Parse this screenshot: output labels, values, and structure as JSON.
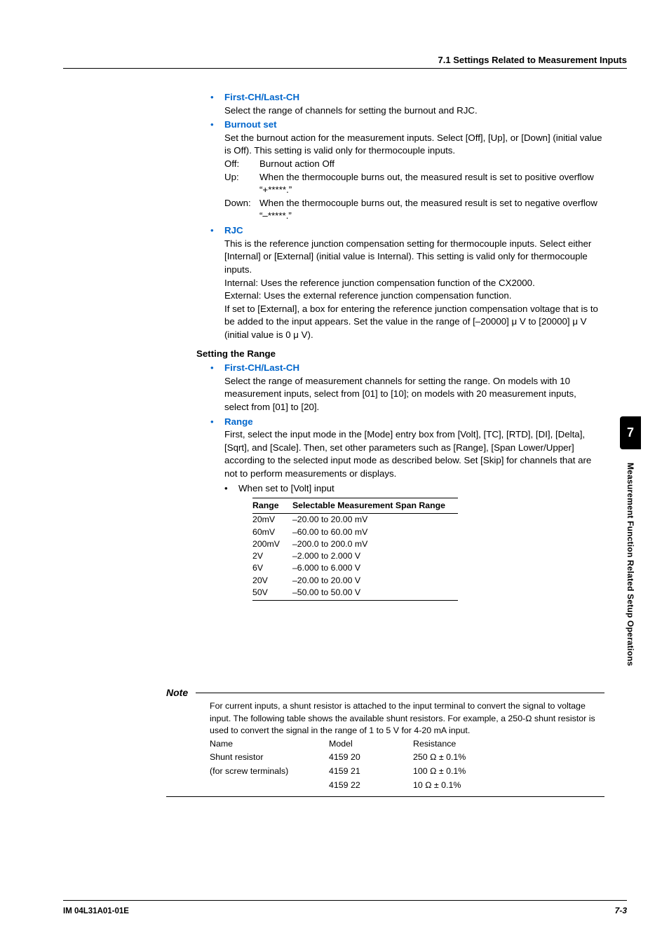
{
  "header": {
    "section": "7.1  Settings Related to Measurement Inputs"
  },
  "footer": {
    "left": "IM 04L31A01-01E",
    "right": "7-3"
  },
  "side": {
    "chapter": "7",
    "title": "Measurement Function Related Setup Operations"
  },
  "b1": {
    "h": "First-CH/Last-CH",
    "p": "Select the range of channels for setting the burnout and RJC."
  },
  "b2": {
    "h": "Burnout set",
    "p": "Set the burnout action for the measurement inputs.  Select [Off], [Up], or [Down] (initial value is Off).  This setting is valid only for thermocouple inputs.",
    "off_t": "Off:",
    "off_d": "Burnout action Off",
    "up_t": "Up:",
    "up_d": "When the thermocouple burns out, the measured result is set to positive overflow “+*****.”",
    "dn_t": "Down:",
    "dn_d": "When the thermocouple burns out, the measured result is set to negative overflow “–*****.”"
  },
  "b3": {
    "h": "RJC",
    "p1": "This is the reference junction compensation setting for thermocouple inputs.  Select either [Internal] or [External] (initial value is Internal).  This setting is valid only for thermocouple inputs.",
    "p2": "Internal: Uses the reference junction compensation function of the CX2000.",
    "p3": "External: Uses the external reference junction compensation function.",
    "p4": "If set to [External], a box for entering the reference junction compensation voltage that is to be added to the input appears.  Set the value in the range of [–20000] μ V to [20000] μ V (initial value is 0 μ V)."
  },
  "sr": {
    "h": "Setting the Range",
    "b1h": "First-CH/Last-CH",
    "b1p": "Select the range of measurement channels for setting the range.  On models with 10 measurement inputs, select from [01] to [10]; on models with 20 measurement inputs, select from [01] to [20].",
    "b2h": "Range",
    "b2p": "First, select the input mode in the [Mode] entry box from [Volt], [TC], [RTD], [DI], [Delta], [Sqrt], and [Scale].  Then, set other parameters such as [Range], [Span Lower/Upper] according to the selected input mode as described below.  Set [Skip] for channels that are not to perform measurements or displays.",
    "volt": "When set to [Volt] input"
  },
  "chart_data": {
    "type": "table",
    "title": "Selectable Measurement Span Range (Volt input)",
    "columns": [
      "Range",
      "Selectable Measurement Span Range"
    ],
    "rows": [
      [
        "20mV",
        "–20.00 to 20.00 mV"
      ],
      [
        "60mV",
        "–60.00 to 60.00 mV"
      ],
      [
        "200mV",
        "–200.0 to 200.0 mV"
      ],
      [
        "2V",
        "–2.000 to 2.000 V"
      ],
      [
        "6V",
        "–6.000 to 6.000 V"
      ],
      [
        "20V",
        "–20.00 to 20.00 V"
      ],
      [
        "50V",
        "–50.00 to 50.00 V"
      ]
    ]
  },
  "note": {
    "h": "Note",
    "p": "For current inputs, a shunt resistor is attached to the input terminal to convert the signal to voltage input.  The following table shows the available shunt resistors.  For example, a 250-Ω shunt resistor is used to convert the signal in the range of 1 to 5 V for 4-20 mA input.",
    "cols": [
      "Name",
      "Model",
      "Resistance"
    ],
    "rows": [
      [
        "Shunt resistor",
        "4159 20",
        "250 Ω ± 0.1%"
      ],
      [
        "(for screw terminals)",
        "4159 21",
        "100 Ω ± 0.1%"
      ],
      [
        "",
        "4159 22",
        "10 Ω ± 0.1%"
      ]
    ]
  }
}
